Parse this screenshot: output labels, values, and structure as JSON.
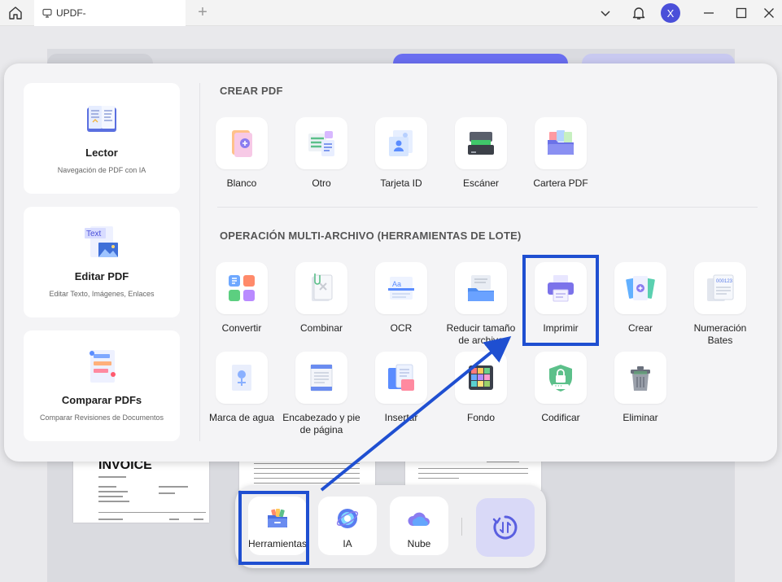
{
  "titlebar": {
    "tab_title": "UPDF-",
    "add_tab": "+",
    "avatar_letter": "X"
  },
  "modes": [
    {
      "title": "Lector",
      "subtitle": "Navegación de PDF con IA"
    },
    {
      "title": "Editar PDF",
      "subtitle": "Editar Texto, Imágenes, Enlaces"
    },
    {
      "title": "Comparar PDFs",
      "subtitle": "Comparar Revisiones de Documentos"
    }
  ],
  "create_section": {
    "title": "CREAR PDF",
    "tools": [
      "Blanco",
      "Otro",
      "Tarjeta ID",
      "Escáner",
      "Cartera PDF"
    ]
  },
  "batch_section": {
    "title": "OPERACIÓN MULTI-ARCHIVO (HERRAMIENTAS DE LOTE)",
    "row1": [
      "Convertir",
      "Combinar",
      "OCR",
      "Reducir tamaño de archivo",
      "Imprimir",
      "Crear",
      "Numeración Bates"
    ],
    "row2": [
      "Marca de agua",
      "Encabezado y pie de página",
      "Insertar",
      "Fondo",
      "Codificar",
      "Eliminar"
    ]
  },
  "dock": {
    "tools": "Herramientas",
    "ai": "IA",
    "cloud": "Nube"
  },
  "background": {
    "invoice_title": "INVOICE"
  },
  "colors": {
    "accent": "#4a4fd9",
    "highlight": "#1f4fd1"
  }
}
